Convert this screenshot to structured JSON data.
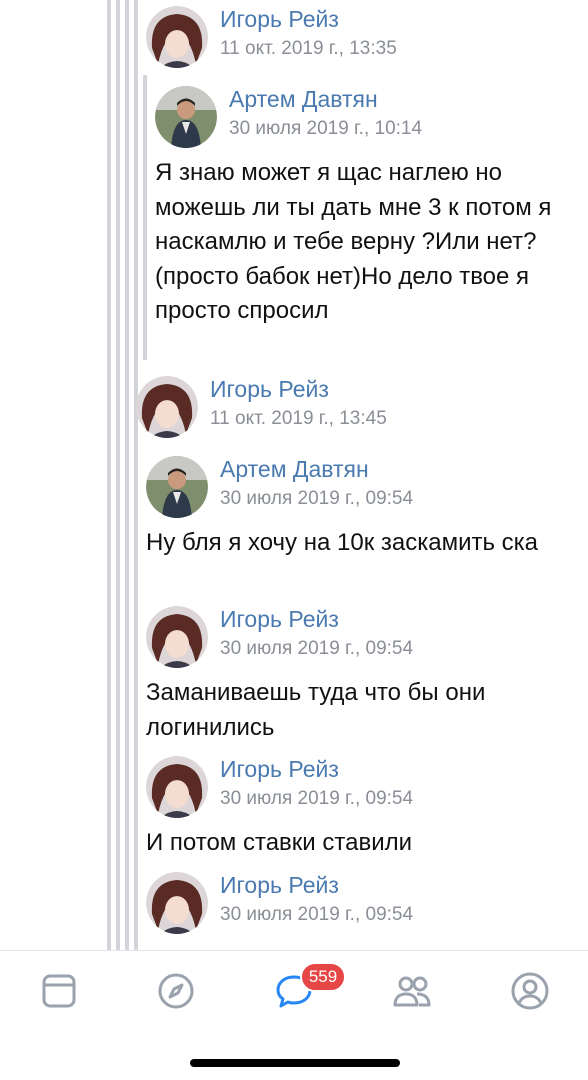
{
  "messages": [
    {
      "author": "Игорь Рейз",
      "date": "11 окт. 2019 г., 13:35",
      "avatar": "anime-avatar-icon",
      "text": ""
    },
    {
      "author": "Артем Давтян",
      "date": "30 июля 2019 г., 10:14",
      "avatar": "photo-avatar-icon",
      "text": "Я знаю может я щас наглею но можешь ли ты дать мне 3 к потом я наскамлю и тебе верну ?Или нет?(просто бабок нет)Но дело твое я просто спросил"
    },
    {
      "author": "Игорь Рейз",
      "date": "11 окт. 2019 г., 13:45",
      "avatar": "anime-avatar-icon",
      "text": ""
    },
    {
      "author": "Артем Давтян",
      "date": "30 июля 2019 г., 09:54",
      "avatar": "photo-avatar-icon",
      "text": "Ну бля я хочу на 10к заскамить ска"
    },
    {
      "author": "Игорь Рейз",
      "date": "30 июля 2019 г., 09:54",
      "avatar": "anime-avatar-icon",
      "text": "Заманиваешь туда что бы они логинились"
    },
    {
      "author": "Игорь Рейз",
      "date": "30 июля 2019 г., 09:54",
      "avatar": "anime-avatar-icon",
      "text": "И потом ставки ставили"
    },
    {
      "author": "Игорь Рейз",
      "date": "30 июля 2019 г., 09:54",
      "avatar": "anime-avatar-icon",
      "text": ""
    }
  ],
  "tabbar": {
    "tabs": [
      "news-icon",
      "discover-icon",
      "messages-icon",
      "friends-icon",
      "profile-icon"
    ],
    "messages_badge": "559",
    "active_color": "#2787f5",
    "inactive_color": "#99a2ad",
    "badge_color": "#e64646"
  }
}
